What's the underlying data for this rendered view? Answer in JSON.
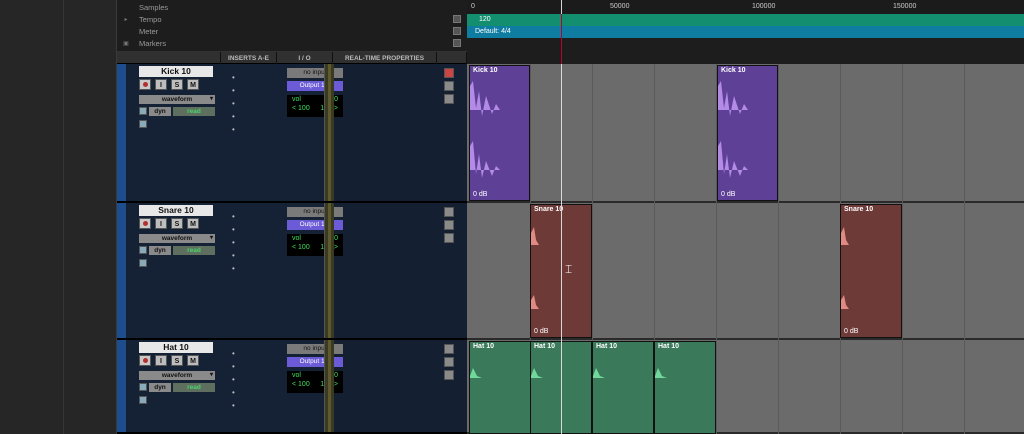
{
  "ruler_rows": [
    "Samples",
    "Tempo",
    "Meter",
    "Markers"
  ],
  "columns": [
    "INSERTS A-E",
    "I / O",
    "REAL-TIME PROPERTIES"
  ],
  "ruler_ticks": [
    "0",
    "50000",
    "100000",
    "150000"
  ],
  "tempo_value": "120",
  "meter_value": "Default: 4/4",
  "tracks": [
    {
      "name": "Kick 10",
      "buttons": [
        "I",
        "S",
        "M"
      ],
      "view": "waveform",
      "automation": "dyn",
      "mode": "read",
      "input": "no input",
      "output": "Output 1-2",
      "vol_label": "vol",
      "vol_value": "0.0",
      "pan_left": "< 100",
      "pan_right": "100 >",
      "clips": [
        {
          "name": "Kick 10",
          "gain": "0 dB"
        },
        {
          "name": "Kick 10",
          "gain": "0 dB"
        }
      ]
    },
    {
      "name": "Snare 10",
      "buttons": [
        "I",
        "S",
        "M"
      ],
      "view": "waveform",
      "automation": "dyn",
      "mode": "read",
      "input": "no input",
      "output": "Output 1-2",
      "vol_label": "vol",
      "vol_value": "0.0",
      "pan_left": "< 100",
      "pan_right": "100 >",
      "clips": [
        {
          "name": "Snare 10",
          "gain": "0 dB"
        },
        {
          "name": "Snare 10",
          "gain": "0 dB"
        }
      ]
    },
    {
      "name": "Hat 10",
      "buttons": [
        "I",
        "S",
        "M"
      ],
      "view": "waveform",
      "automation": "dyn",
      "mode": "read",
      "input": "no input",
      "output": "Output 1-2",
      "vol_label": "vol",
      "vol_value": "0.0",
      "pan_left": "< 100",
      "pan_right": "100 >",
      "clips": [
        {
          "name": "Hat 10"
        },
        {
          "name": "Hat 10"
        },
        {
          "name": "Hat 10"
        },
        {
          "name": "Hat 10"
        }
      ]
    }
  ],
  "colors": {
    "kick": "#6b4aa6",
    "snare": "#6e3a37",
    "hat": "#3a7a5a",
    "tempo": "#138e6e",
    "meter": "#0f7da1",
    "output": "#6b5bd6",
    "read": "#49d46a"
  }
}
